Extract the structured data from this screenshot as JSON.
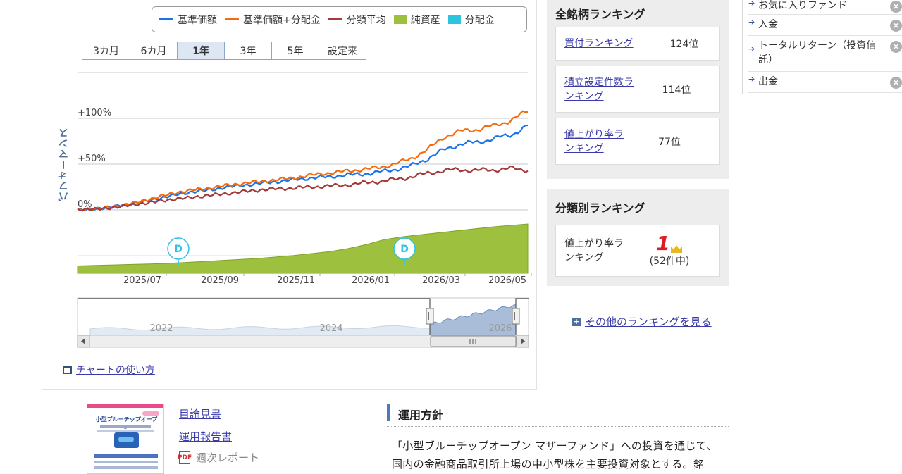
{
  "legend": [
    {
      "label": "基準価額",
      "color": "#1a73e8",
      "kind": "line"
    },
    {
      "label": "基準価額+分配金",
      "color": "#f26b10",
      "kind": "line"
    },
    {
      "label": "分類平均",
      "color": "#a33a3a",
      "kind": "line"
    },
    {
      "label": "純資産",
      "color": "#9dc13f",
      "kind": "box"
    },
    {
      "label": "分配金",
      "color": "#2ec4e0",
      "kind": "box"
    }
  ],
  "ranges": [
    "3カ月",
    "6カ月",
    "1年",
    "3年",
    "5年",
    "設定来"
  ],
  "active_range": "1年",
  "chart_data": {
    "type": "line",
    "ylabel": "パフォーマンス",
    "y_ticks": [
      "+100%",
      "+50%",
      "0%"
    ],
    "y_range_pct": [
      -10,
      150
    ],
    "x_labels": [
      "2025/07",
      "2025/09",
      "2025/11",
      "2026/01",
      "2026/03",
      "2026/05"
    ],
    "dividend_marker": "D",
    "series": [
      {
        "name": "基準価額",
        "color": "#1a73e8",
        "values_pct": [
          0,
          1,
          3,
          6,
          9,
          13,
          17,
          20,
          22,
          25,
          27,
          29,
          31,
          33,
          35,
          36,
          38,
          39,
          41,
          44,
          48,
          56,
          66,
          72,
          74,
          78,
          82,
          92
        ]
      },
      {
        "name": "基準価額+分配金",
        "color": "#f26b10",
        "values_pct": [
          0,
          1,
          3,
          6,
          10,
          15,
          19,
          22,
          24,
          27,
          29,
          31,
          33,
          35,
          38,
          40,
          42,
          44,
          46,
          50,
          56,
          66,
          80,
          86,
          88,
          92,
          98,
          108
        ]
      },
      {
        "name": "分類平均",
        "color": "#a33a3a",
        "values_pct": [
          0,
          1,
          2,
          5,
          7,
          10,
          12,
          14,
          16,
          18,
          20,
          22,
          23,
          24,
          25,
          26,
          27,
          29,
          31,
          33,
          36,
          40,
          43,
          44,
          43,
          44,
          45,
          44
        ]
      }
    ],
    "net_assets": {
      "name": "純資産",
      "color": "#9dc13f",
      "values_rel": [
        0.15,
        0.16,
        0.17,
        0.18,
        0.19,
        0.2,
        0.22,
        0.24,
        0.26,
        0.28,
        0.3,
        0.33,
        0.36,
        0.4,
        0.44,
        0.5,
        0.58,
        0.68,
        0.74,
        0.78,
        0.82,
        0.86,
        0.9,
        0.94,
        0.97,
        1.0
      ]
    },
    "navigator": {
      "x_labels": [
        "2022",
        "2024",
        "2026"
      ]
    }
  },
  "chart_howto": "チャートの使い方",
  "all_ranking": {
    "title": "全銘柄ランキング",
    "items": [
      {
        "name": "買付ランキング",
        "value": "124位"
      },
      {
        "name": "積立設定件数ランキング",
        "value": "114位"
      },
      {
        "name": "値上がり率ランキング",
        "value": "77位"
      }
    ]
  },
  "category_ranking": {
    "title": "分類別ランキング",
    "name": "値上がり率ランキング",
    "rank": "1",
    "count": "(52件中)"
  },
  "more_ranking": "その他のランキングを見る",
  "side_menu": [
    {
      "label": "お気に入りファンド"
    },
    {
      "label": "入金"
    },
    {
      "label": "トータルリターン（投資信託）"
    },
    {
      "label": "出金"
    }
  ],
  "docs": {
    "prospectus": "目論見書",
    "report": "運用報告書",
    "weekly": "週次レポート",
    "thumb_title": "小型ブルーチップオープン"
  },
  "policy": {
    "title": "運用方針",
    "text": "「小型ブルーチップオープン マザーファンド」への投資を通じて、国内の金融商品取引所上場の中小型株を主要投資対象とする。銘"
  }
}
